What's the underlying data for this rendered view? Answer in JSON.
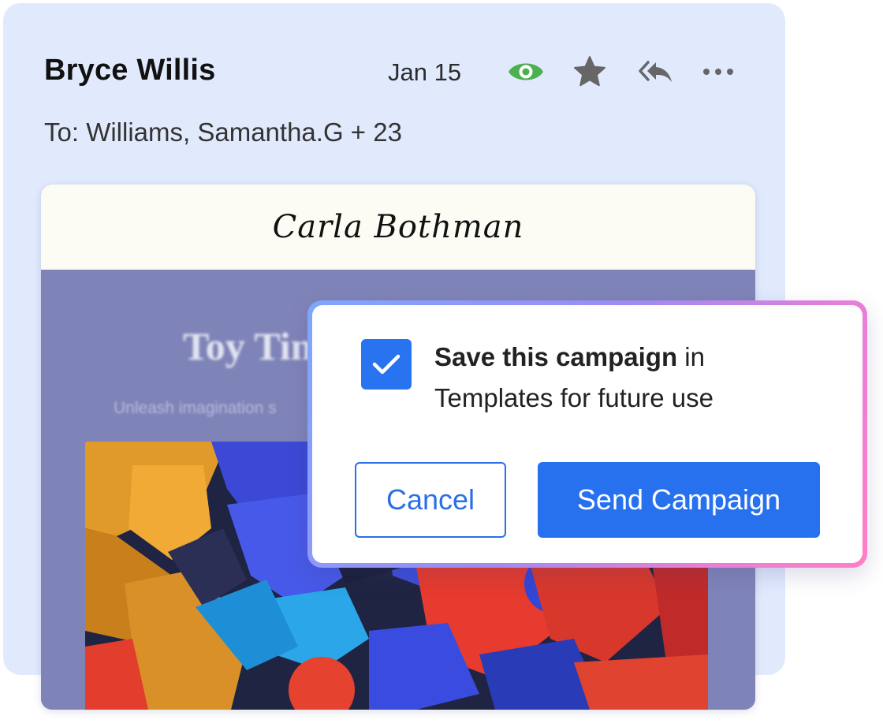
{
  "email": {
    "sender": "Bryce Willis",
    "date": "Jan 15",
    "recipients": "To: Williams, Samantha.G + 23",
    "actions": [
      {
        "icon": "eye-icon",
        "color": "#4caf50"
      },
      {
        "icon": "star-icon",
        "color": "#666666"
      },
      {
        "icon": "reply-all-icon",
        "color": "#666666"
      },
      {
        "icon": "more-icon",
        "color": "#666666"
      }
    ]
  },
  "preview": {
    "brand": "Carla Bothman",
    "title": "Toy Tin",
    "subtitle": "Unleash imagination s",
    "image": "colorful-toy-blocks-image"
  },
  "dialog": {
    "checkbox_checked": true,
    "message_bold": "Save this campaign",
    "message_rest": " in",
    "message_line2": "Templates for future use",
    "cancel_label": "Cancel",
    "send_label": "Send Campaign"
  },
  "colors": {
    "card_bg": "#e1eafd",
    "accent": "#2771ef",
    "preview_bg": "#7f84b8",
    "eye_icon": "#4caf50"
  }
}
